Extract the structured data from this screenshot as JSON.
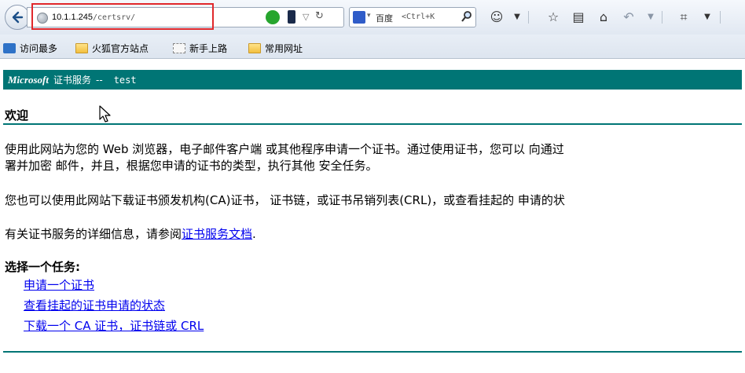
{
  "browser": {
    "url_host": "10.1.1.245",
    "url_path": "/certsrv/",
    "search_engine": "百度",
    "search_placeholder": "<Ctrl+K",
    "icons": [
      "back-icon",
      "globe-icon",
      "go-icon",
      "mobile-icon",
      "dropdown-icon",
      "reload-icon",
      "baidu-icon",
      "search-icon",
      "addon-icon",
      "star-icon",
      "reader-icon",
      "home-icon",
      "undo-icon",
      "crop-icon"
    ]
  },
  "bookmarks": [
    {
      "label": "访问最多",
      "icon": "most-visited-icon"
    },
    {
      "label": "火狐官方站点",
      "icon": "folder-icon"
    },
    {
      "label": "新手上路",
      "icon": "dashed-folder-icon"
    },
    {
      "label": "常用网址",
      "icon": "folder-icon"
    }
  ],
  "page": {
    "brand": "Microsoft",
    "service": "证书服务",
    "separator": "--",
    "host": "test",
    "welcome": "欢迎",
    "p1_line1": "使用此网站为您的 Web 浏览器，电子邮件客户端 或其他程序申请一个证书。通过使用证书，您可以 向通过",
    "p1_line2": "署并加密 邮件，并且，根据您申请的证书的类型，执行其他 安全任务。",
    "p2": "您也可以使用此网站下载证书颁发机构(CA)证书， 证书链，或证书吊销列表(CRL)，或查看挂起的 申请的状",
    "p3_prefix": "有关证书服务的详细信息，请参阅",
    "p3_link": "证书服务文档",
    "p3_suffix": ".",
    "task_title": "选择一个任务:",
    "tasks": [
      "申请一个证书",
      "查看挂起的证书申请的状态",
      "下载一个 CA 证书，证书链或 CRL"
    ]
  },
  "colors": {
    "banner": "#007575",
    "link": "#0000ee",
    "highlight": "#e0282c"
  }
}
